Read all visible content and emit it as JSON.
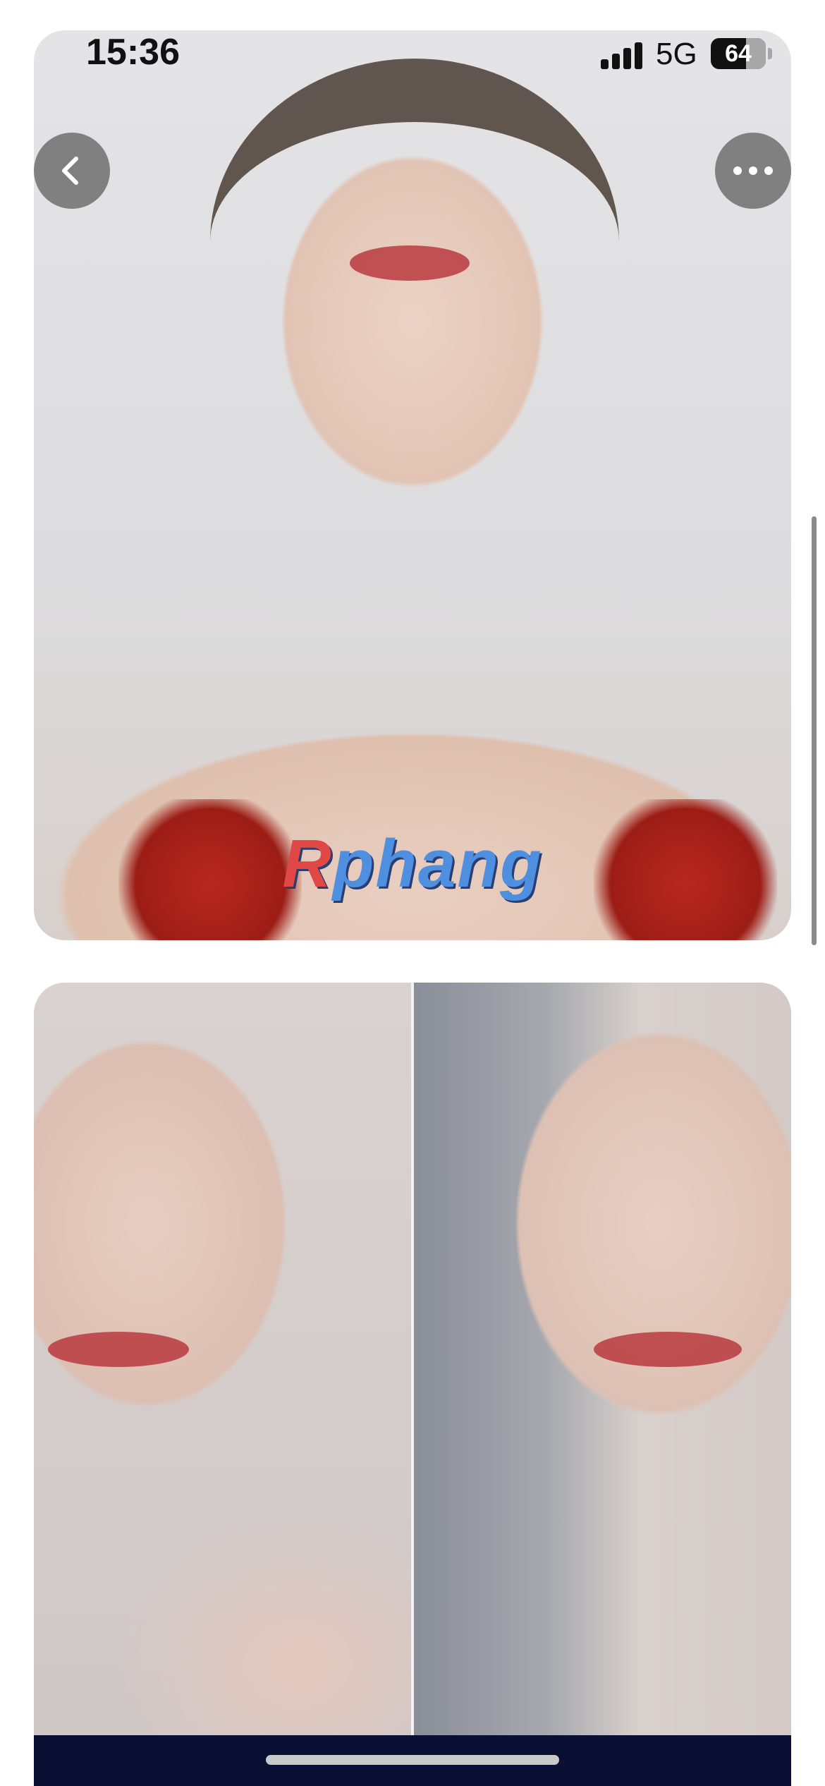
{
  "status_bar": {
    "time": "15:36",
    "network": "5G",
    "battery_level": "64",
    "battery_percent": 64,
    "signal_bars": 4
  },
  "toolbar": {
    "back_icon": "chevron-left-icon",
    "more_icon": "ellipsis-icon"
  },
  "watermark": {
    "first_letter": "R",
    "rest": "phang"
  },
  "colors": {
    "button_bg": "#6e6e6e",
    "bottom_bar": "#0a1033",
    "watermark_blue": "#4f8fe0",
    "watermark_red": "#e04848"
  }
}
